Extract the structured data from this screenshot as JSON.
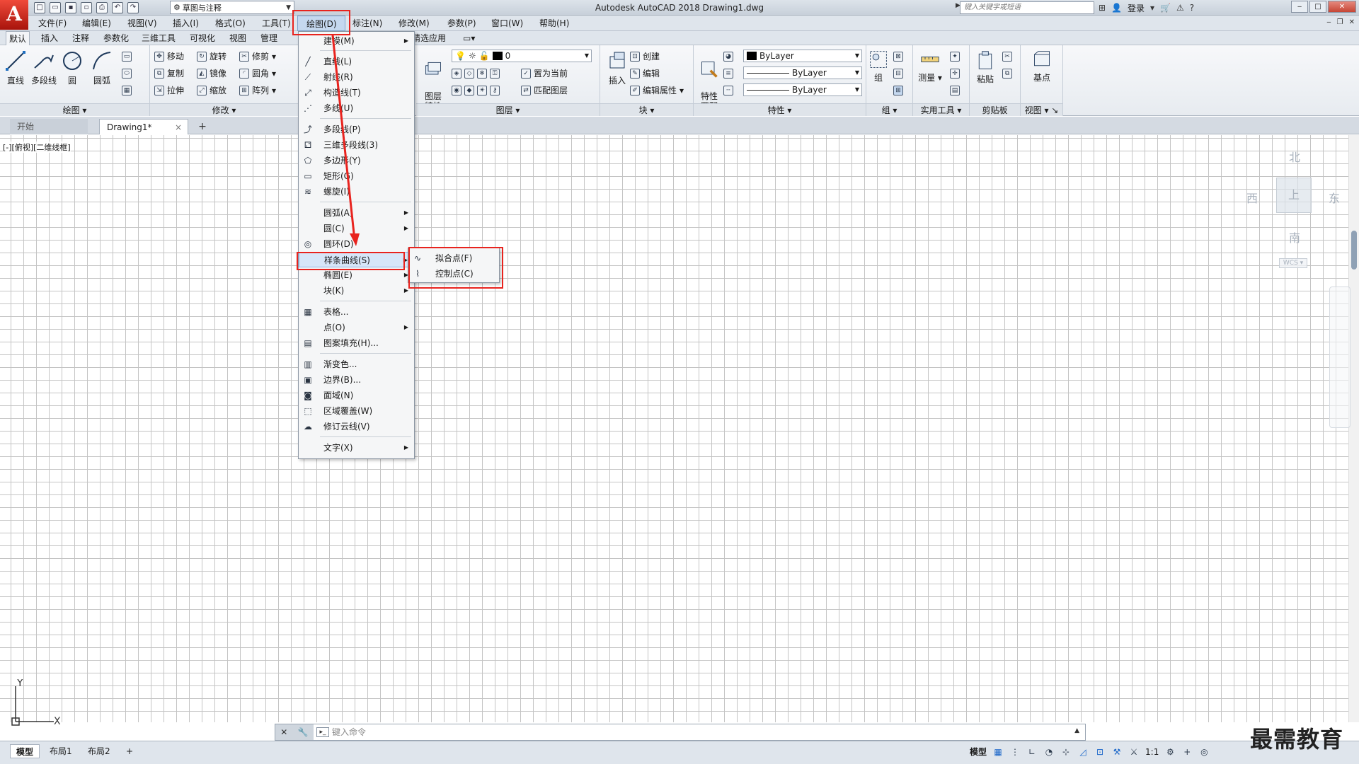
{
  "app": {
    "logo": "A",
    "title": "Autodesk AutoCAD 2018    Drawing1.dwg",
    "workspace": "草图与注释",
    "search_placeholder": "键入关键字或短语",
    "login": "登录"
  },
  "menubar": {
    "items": [
      "文件(F)",
      "编辑(E)",
      "视图(V)",
      "插入(I)",
      "格式(O)",
      "工具(T)",
      "绘图(D)",
      "标注(N)",
      "修改(M)",
      "参数(P)",
      "窗口(W)",
      "帮助(H)"
    ]
  },
  "ribbon_tabs": {
    "items": [
      "默认",
      "插入",
      "注释",
      "参数化",
      "三维工具",
      "可视化",
      "视图",
      "管理",
      "精选应用"
    ]
  },
  "ribbon": {
    "draw": {
      "title": "绘图",
      "line": "直线",
      "polyline": "多段线",
      "circle": "圆",
      "arc": "圆弧"
    },
    "modify": {
      "title": "修改",
      "move": "移动",
      "rotate": "旋转",
      "trim": "修剪",
      "copy": "复制",
      "mirror": "镜像",
      "fillet": "圆角",
      "stretch": "拉伸",
      "scale": "缩放",
      "array": "阵列"
    },
    "layers": {
      "title": "图层",
      "props": "图层\n特性",
      "layer_value": "0",
      "set_current": "置为当前",
      "match": "匹配图层"
    },
    "block": {
      "title": "块",
      "insert": "插入",
      "create": "创建",
      "edit": "编辑",
      "edit_attr": "编辑属性"
    },
    "properties": {
      "title": "特性",
      "match": "特性\n匹配",
      "color": "ByLayer",
      "linetype": "ByLayer",
      "lineweight": "ByLayer"
    },
    "groups": {
      "title": "组",
      "group": "组"
    },
    "utilities": {
      "title": "实用工具",
      "measure": "测量"
    },
    "clipboard": {
      "title": "剪贴板",
      "paste": "粘贴"
    },
    "view": {
      "title": "视图",
      "base": "基点"
    }
  },
  "filetabs": {
    "start": "开始",
    "current": "Drawing1*",
    "close": "×",
    "add": "+"
  },
  "viewport": {
    "label": "[-][俯视][二维线框]",
    "viewcube": {
      "north": "北",
      "south": "南",
      "east": "东",
      "west": "西",
      "top": "上",
      "wcs": "WCS"
    },
    "ucs_x": "X",
    "ucs_y": "Y"
  },
  "draw_menu": {
    "items": [
      {
        "label": "建模(M)",
        "icon": "none",
        "submenu": true
      },
      {
        "label": "直线(L)",
        "icon": "line-icon",
        "submenu": false
      },
      {
        "label": "射线(R)",
        "icon": "ray-icon",
        "submenu": false
      },
      {
        "label": "构造线(T)",
        "icon": "xline-icon",
        "submenu": false
      },
      {
        "label": "多线(U)",
        "icon": "mline-icon",
        "submenu": false
      },
      {
        "label": "多段线(P)",
        "icon": "polyline-icon",
        "submenu": false
      },
      {
        "label": "三维多段线(3)",
        "icon": "3dpoly-icon",
        "submenu": false
      },
      {
        "label": "多边形(Y)",
        "icon": "polygon-icon",
        "submenu": false
      },
      {
        "label": "矩形(G)",
        "icon": "rectangle-icon",
        "submenu": false
      },
      {
        "label": "螺旋(I)",
        "icon": "helix-icon",
        "submenu": false
      },
      {
        "label": "圆弧(A)",
        "icon": "none",
        "submenu": true
      },
      {
        "label": "圆(C)",
        "icon": "none",
        "submenu": true
      },
      {
        "label": "圆环(D)",
        "icon": "donut-icon",
        "submenu": false
      },
      {
        "label": "样条曲线(S)",
        "icon": "none",
        "submenu": true
      },
      {
        "label": "椭圆(E)",
        "icon": "none",
        "submenu": true
      },
      {
        "label": "块(K)",
        "icon": "none",
        "submenu": true
      },
      {
        "label": "表格...",
        "icon": "table-icon",
        "submenu": false
      },
      {
        "label": "点(O)",
        "icon": "none",
        "submenu": true
      },
      {
        "label": "图案填充(H)...",
        "icon": "hatch-icon",
        "submenu": false
      },
      {
        "label": "渐变色...",
        "icon": "gradient-icon",
        "submenu": false
      },
      {
        "label": "边界(B)...",
        "icon": "boundary-icon",
        "submenu": false
      },
      {
        "label": "面域(N)",
        "icon": "region-icon",
        "submenu": false
      },
      {
        "label": "区域覆盖(W)",
        "icon": "wipeout-icon",
        "submenu": false
      },
      {
        "label": "修订云线(V)",
        "icon": "revcloud-icon",
        "submenu": false
      },
      {
        "label": "文字(X)",
        "icon": "none",
        "submenu": true
      }
    ]
  },
  "spline_submenu": {
    "items": [
      "拟合点(F)",
      "控制点(C)"
    ]
  },
  "command_line": {
    "placeholder": "键入命令"
  },
  "status": {
    "tabs": [
      "模型",
      "布局1",
      "布局2"
    ],
    "add": "+",
    "right_label": "模型",
    "scale": "1:1"
  },
  "watermark": "最需教育",
  "colors": {
    "highlight_box": "#e8231e",
    "menu_hover": "#d7e6f8",
    "accent": "#1a66c9"
  }
}
